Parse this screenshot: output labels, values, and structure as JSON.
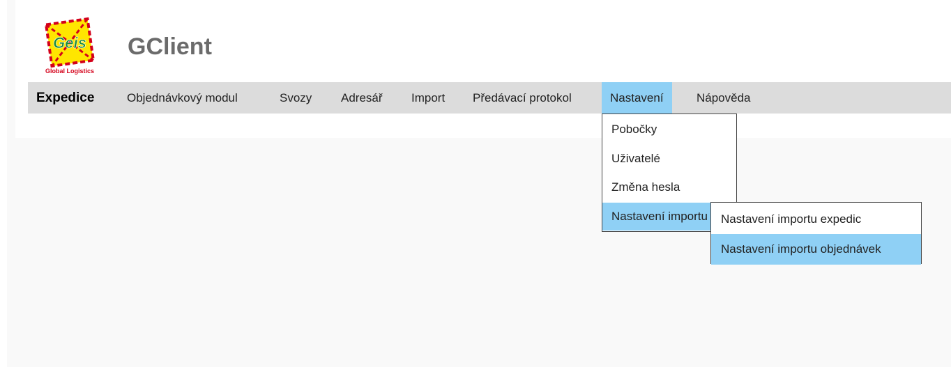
{
  "header": {
    "logo_text": "Geis",
    "logo_caption": "Global Logistics",
    "app_title": "GClient"
  },
  "menu": {
    "brand": "Expedice",
    "items": [
      {
        "label": "Objednávkový modul"
      },
      {
        "label": "Svozy"
      },
      {
        "label": "Adresář"
      },
      {
        "label": "Import"
      },
      {
        "label": "Předávací protokol"
      },
      {
        "label": "Nastavení"
      },
      {
        "label": "Nápověda"
      }
    ],
    "active": "Nastavení"
  },
  "dropdown": {
    "items": [
      {
        "label": "Pobočky"
      },
      {
        "label": "Uživatelé"
      },
      {
        "label": "Změna hesla"
      },
      {
        "label": "Nastavení importu"
      }
    ]
  },
  "submenu": {
    "items": [
      {
        "label": "Nastavení importu expedic"
      },
      {
        "label": "Nastavení importu objednávek"
      }
    ]
  },
  "colors": {
    "highlight": "#8fd0f5",
    "menubar": "#dcdcdc",
    "title": "#6b6b6b",
    "logo_yellow": "#ffe600",
    "logo_red": "#d4001a"
  }
}
